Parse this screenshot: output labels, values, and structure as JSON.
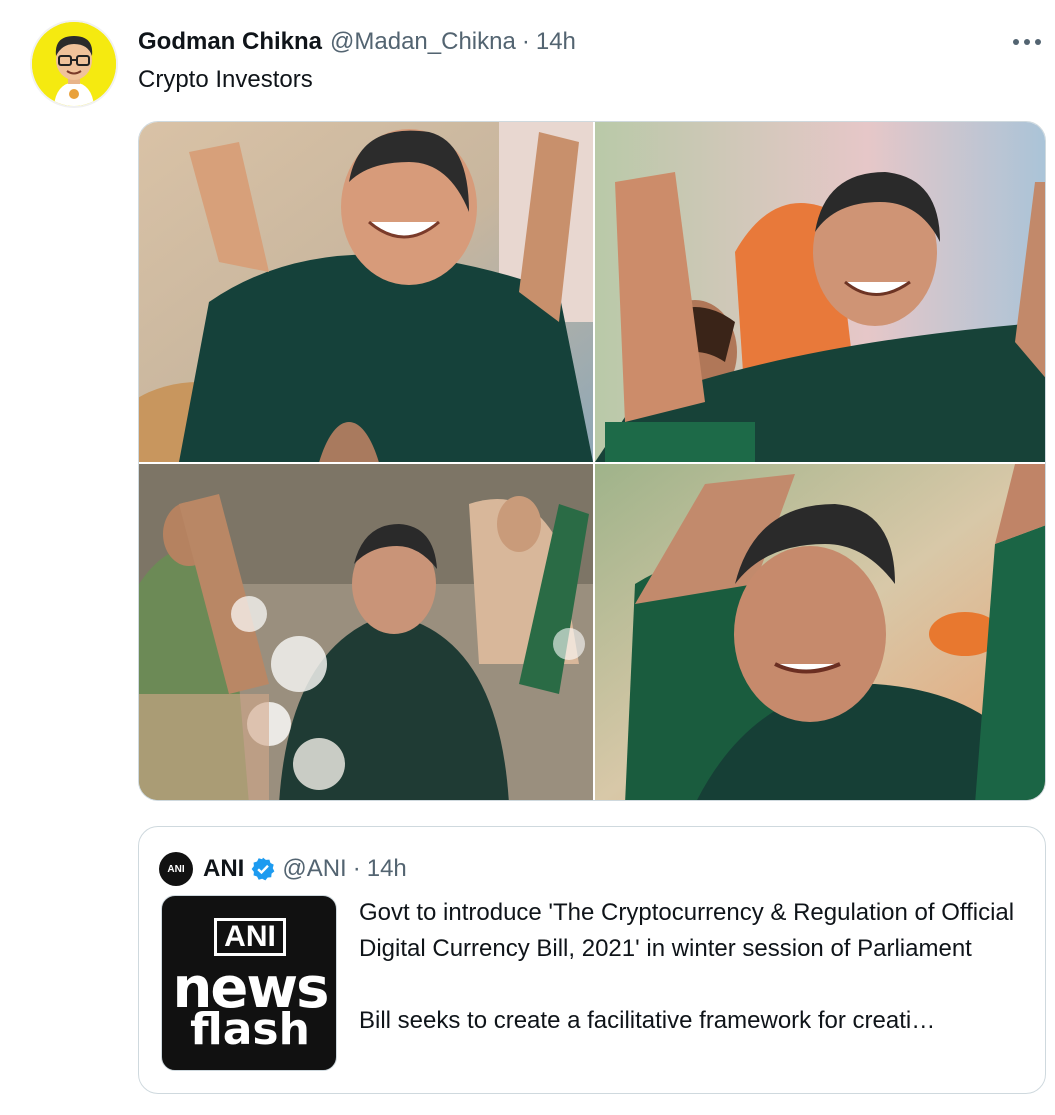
{
  "tweet": {
    "display_name": "Godman Chikna",
    "handle": "@Madan_Chikna",
    "separator": "·",
    "time": "14h",
    "more_icon": "more-horizontal-icon",
    "text": "Crypto Investors",
    "avatar_bg": "#f5ea10"
  },
  "quote": {
    "display_name": "ANI",
    "handle": "@ANI",
    "separator": "·",
    "time": "14h",
    "avatar_label": "ANI",
    "thumbnail": {
      "line1": "ANI",
      "line2": "news",
      "line3": "flash"
    },
    "paragraph1": "Govt to introduce 'The Cryptocurrency & Regulation of Official Digital Currency Bill, 2021' in winter session of Parliament",
    "paragraph2": "Bill seeks to create a facilitative framework for creati…",
    "verified_color": "#1d9bf0"
  },
  "colors": {
    "secondary_text": "#536471",
    "border": "#cfd9de"
  }
}
